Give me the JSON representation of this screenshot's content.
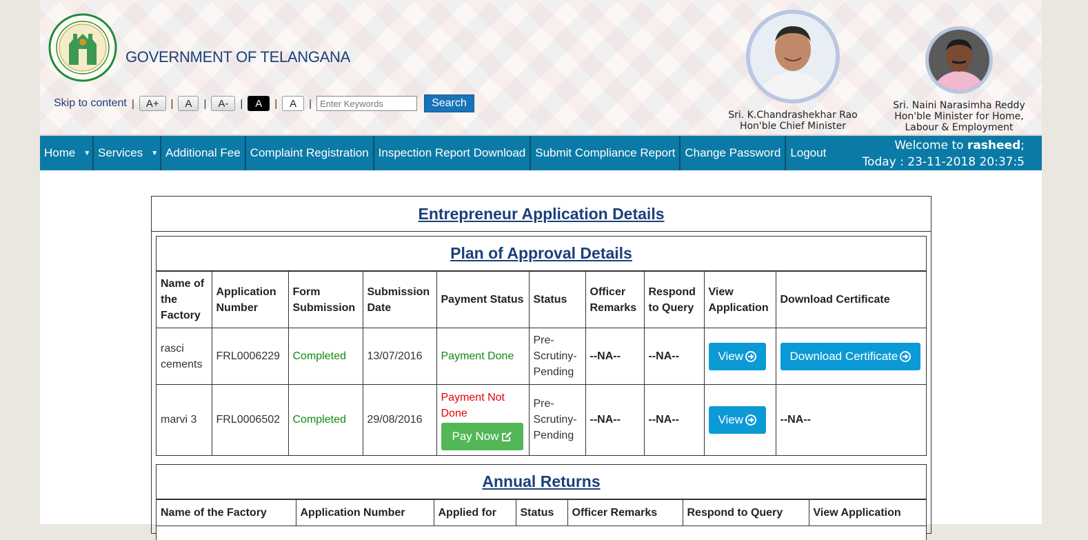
{
  "header": {
    "gov_title": "GOVERNMENT OF TELANGANA",
    "skip_label": "Skip to content",
    "font_buttons": [
      "A+",
      "A",
      "A-",
      "A",
      "A"
    ],
    "search_placeholder": "Enter Keywords",
    "search_label": "Search",
    "cm_name": "Sri. K.Chandrashekhar Rao",
    "cm_title": "Hon'ble Chief Minister",
    "minister_name": "Sri. Naini Narasimha Reddy",
    "minister_title_1": "Hon'ble Minister for Home,",
    "minister_title_2": "Labour & Employment"
  },
  "nav": {
    "items": [
      "Home",
      "Services",
      "Additional Fee",
      "Complaint Registration",
      "Inspection Report Download",
      "Submit Compliance Report",
      "Change Password",
      "Logout"
    ],
    "welcome_prefix": "Welcome to",
    "username": "rasheed",
    "welcome_suffix": ";",
    "today": "Today : 23-11-2018 20:37:5"
  },
  "main": {
    "title": "Entrepreneur Application Details",
    "plan": {
      "title": "Plan of Approval Details",
      "headers": [
        "Name of the Factory",
        "Application Number",
        "Form Submission",
        "Submission Date",
        "Payment Status",
        "Status",
        "Officer Remarks",
        "Respond to Query",
        "View Application",
        "Download Certificate"
      ],
      "rows": [
        {
          "factory": "rasci cements",
          "app_no": "FRL0006229",
          "form": "Completed",
          "date": "13/07/2016",
          "payment": "Payment Done",
          "status": "Pre-Scrutiny-Pending",
          "remarks": "--NA--",
          "query": "--NA--",
          "view": "View",
          "download": "Download Certificate"
        },
        {
          "factory": "marvi 3",
          "app_no": "FRL0006502",
          "form": "Completed",
          "date": "29/08/2016",
          "payment": "Payment Not Done",
          "pay_now": "Pay Now",
          "status": "Pre-Scrutiny-Pending",
          "remarks": "--NA--",
          "query": "--NA--",
          "view": "View",
          "download": "--NA--"
        }
      ]
    },
    "annual": {
      "title": "Annual Returns",
      "headers": [
        "Name of the Factory",
        "Application Number",
        "Applied for",
        "Status",
        "Officer Remarks",
        "Respond to Query",
        "View Application"
      ]
    }
  },
  "colors": {
    "nav_bg": "#0b7aa6",
    "title_blue": "#1b3f7a",
    "button_blue": "#0c9ad6",
    "button_green": "#53b757",
    "status_green": "#138813",
    "status_red": "#e60000"
  }
}
